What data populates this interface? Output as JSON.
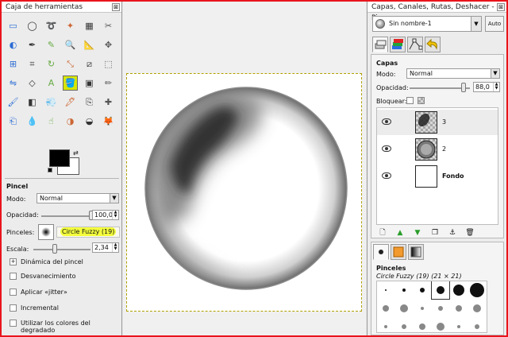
{
  "toolbox": {
    "title": "Caja de herramientas",
    "close_label": "⊠",
    "tool_icons": [
      "rect-select-icon",
      "ellipse-select-icon",
      "free-select-icon",
      "fuzzy-select-icon",
      "color-select-icon",
      "scissors-icon",
      "foreground-select-icon",
      "paths-icon",
      "color-picker-icon",
      "zoom-icon",
      "measure-icon",
      "move-icon",
      "align-icon",
      "crop-icon",
      "rotate-icon",
      "scale-icon",
      "shear-icon",
      "perspective-icon",
      "flip-icon",
      "cage-icon",
      "text-icon",
      "bucket-fill-icon",
      "blend-icon",
      "pencil-icon",
      "paintbrush-icon",
      "eraser-icon",
      "airbrush-icon",
      "ink-icon",
      "clone-icon",
      "heal-icon",
      "perspective-clone-icon",
      "blur-icon",
      "smudge-icon",
      "dodge-burn-icon",
      "colorize-icon",
      "gimp-logo-icon"
    ],
    "selected_tool_index": 21
  },
  "tool_options": {
    "header": "Pincel",
    "mode_label": "Modo:",
    "mode_value": "Normal",
    "opacity_label": "Opacidad:",
    "opacity_value": "100,0",
    "opacity_fraction": 1.0,
    "brushes_label": "Pinceles:",
    "brush_name": "Circle Fuzzy (19)",
    "scale_label": "Escala:",
    "scale_value": "2,34",
    "dynamics_label": "Dinámica del pincel",
    "fade_label": "Desvanecimiento",
    "jitter_label": "Aplicar «jitter»",
    "incremental_label": "Incremental",
    "gradient_colors_label": "Utilizar los colores del degradado"
  },
  "colors": {
    "foreground": "#000000",
    "background": "#ffffff",
    "highlight": "#f4ff3d",
    "frame_border": "#e8141c"
  },
  "dock": {
    "title": "Capas, Canales, Rutas, Deshacer - Pi...",
    "close_label": "⊠",
    "image_name": "Sin nombre-1",
    "auto_label": "Auto",
    "layers": {
      "header": "Capas",
      "mode_label": "Modo:",
      "mode_value": "Normal",
      "opacity_label": "Opacidad:",
      "opacity_value": "88,0",
      "opacity_fraction": 0.88,
      "lock_label": "Bloquear:",
      "items": [
        {
          "name": "3",
          "bold": false
        },
        {
          "name": "2",
          "bold": false
        },
        {
          "name": "Fondo",
          "bold": true
        }
      ]
    },
    "brushes_panel": {
      "header": "Pinceles",
      "current": "Circle Fuzzy (19) (21 × 21)"
    }
  }
}
